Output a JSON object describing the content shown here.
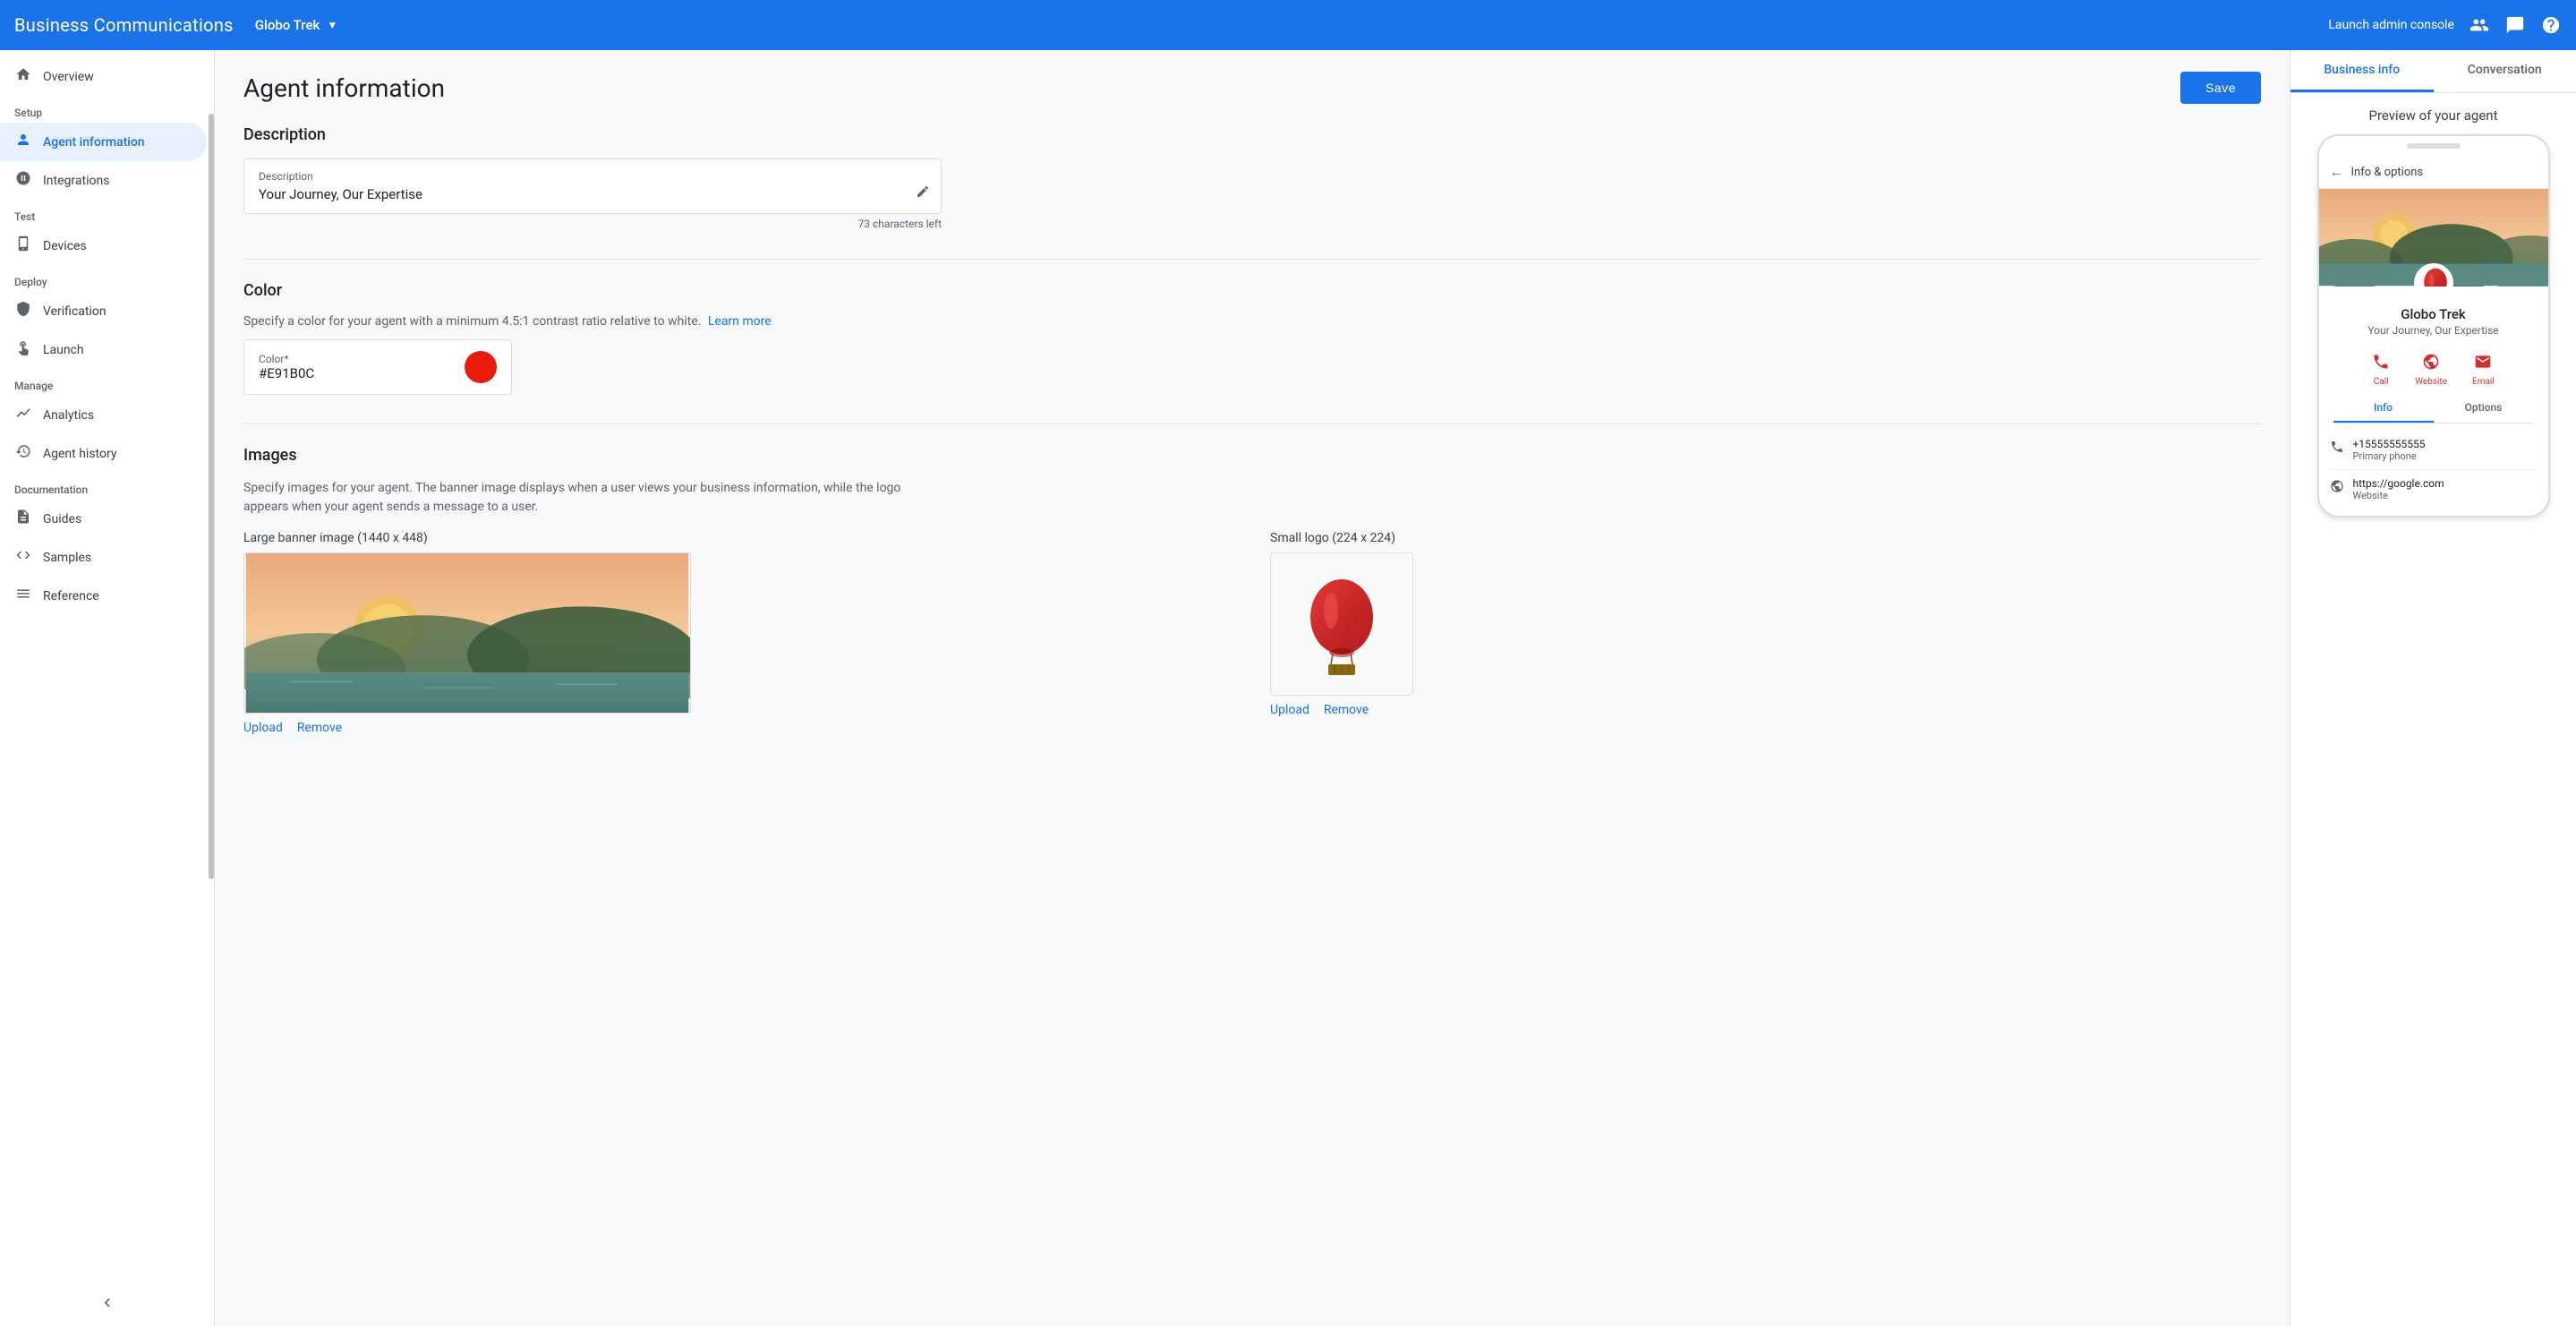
{
  "app": {
    "title": "Business Communications",
    "brand": "Globo Trek",
    "launch_admin": "Launch admin console",
    "nav_icons": [
      "people-icon",
      "chat-icon",
      "help-icon"
    ]
  },
  "sidebar": {
    "sections": [
      {
        "label": "Setup",
        "items": [
          {
            "id": "overview",
            "label": "Overview",
            "icon": "🏠",
            "active": false
          },
          {
            "id": "agent-information",
            "label": "Agent information",
            "icon": "👤",
            "active": true
          },
          {
            "id": "integrations",
            "label": "Integrations",
            "icon": "⚙️",
            "active": false
          }
        ]
      },
      {
        "label": "Test",
        "items": [
          {
            "id": "devices",
            "label": "Devices",
            "icon": "📱",
            "active": false
          }
        ]
      },
      {
        "label": "Deploy",
        "items": [
          {
            "id": "verification",
            "label": "Verification",
            "icon": "🛡️",
            "active": false
          },
          {
            "id": "launch",
            "label": "Launch",
            "icon": "🚀",
            "active": false
          }
        ]
      },
      {
        "label": "Manage",
        "items": [
          {
            "id": "analytics",
            "label": "Analytics",
            "icon": "📈",
            "active": false
          },
          {
            "id": "agent-history",
            "label": "Agent history",
            "icon": "🕐",
            "active": false
          }
        ]
      },
      {
        "label": "Documentation",
        "items": [
          {
            "id": "guides",
            "label": "Guides",
            "icon": "📄",
            "active": false
          },
          {
            "id": "samples",
            "label": "Samples",
            "icon": "⟨⟩",
            "active": false
          },
          {
            "id": "reference",
            "label": "Reference",
            "icon": "☰",
            "active": false
          }
        ]
      }
    ]
  },
  "main": {
    "page_title": "Agent information",
    "save_button": "Save",
    "description": {
      "section_title": "Description",
      "label": "Description",
      "value": "Your Journey, Our Expertise",
      "counter": "73 characters left"
    },
    "color": {
      "section_title": "Color",
      "subtitle": "Specify a color for your agent with a minimum 4.5:1 contrast ratio relative to white.",
      "learn_more": "Learn more",
      "label": "Color*",
      "value": "#E91B0C",
      "swatch_color": "#E91B0C"
    },
    "images": {
      "section_title": "Images",
      "subtitle": "Specify images for your agent. The banner image displays when a user views your business information, while the logo appears when your agent sends a message to a user.",
      "banner_label": "Large banner image (1440 x 448)",
      "logo_label": "Small logo (224 x 224)",
      "upload_label": "Upload",
      "remove_label": "Remove"
    }
  },
  "preview": {
    "tab_business_info": "Business info",
    "tab_conversation": "Conversation",
    "preview_title": "Preview of your agent",
    "phone": {
      "header": "Info & options",
      "agent_name": "Globo Trek",
      "agent_desc": "Your Journey, Our Expertise",
      "actions": [
        {
          "label": "Call",
          "icon": "📞"
        },
        {
          "label": "Website",
          "icon": "🌐"
        },
        {
          "label": "Email",
          "icon": "✉️"
        }
      ],
      "tab_info": "Info",
      "tab_options": "Options",
      "info_rows": [
        {
          "icon": "📞",
          "main": "+15555555555",
          "sub": "Primary phone"
        },
        {
          "icon": "🌐",
          "main": "https://google.com",
          "sub": "Website"
        }
      ]
    }
  }
}
